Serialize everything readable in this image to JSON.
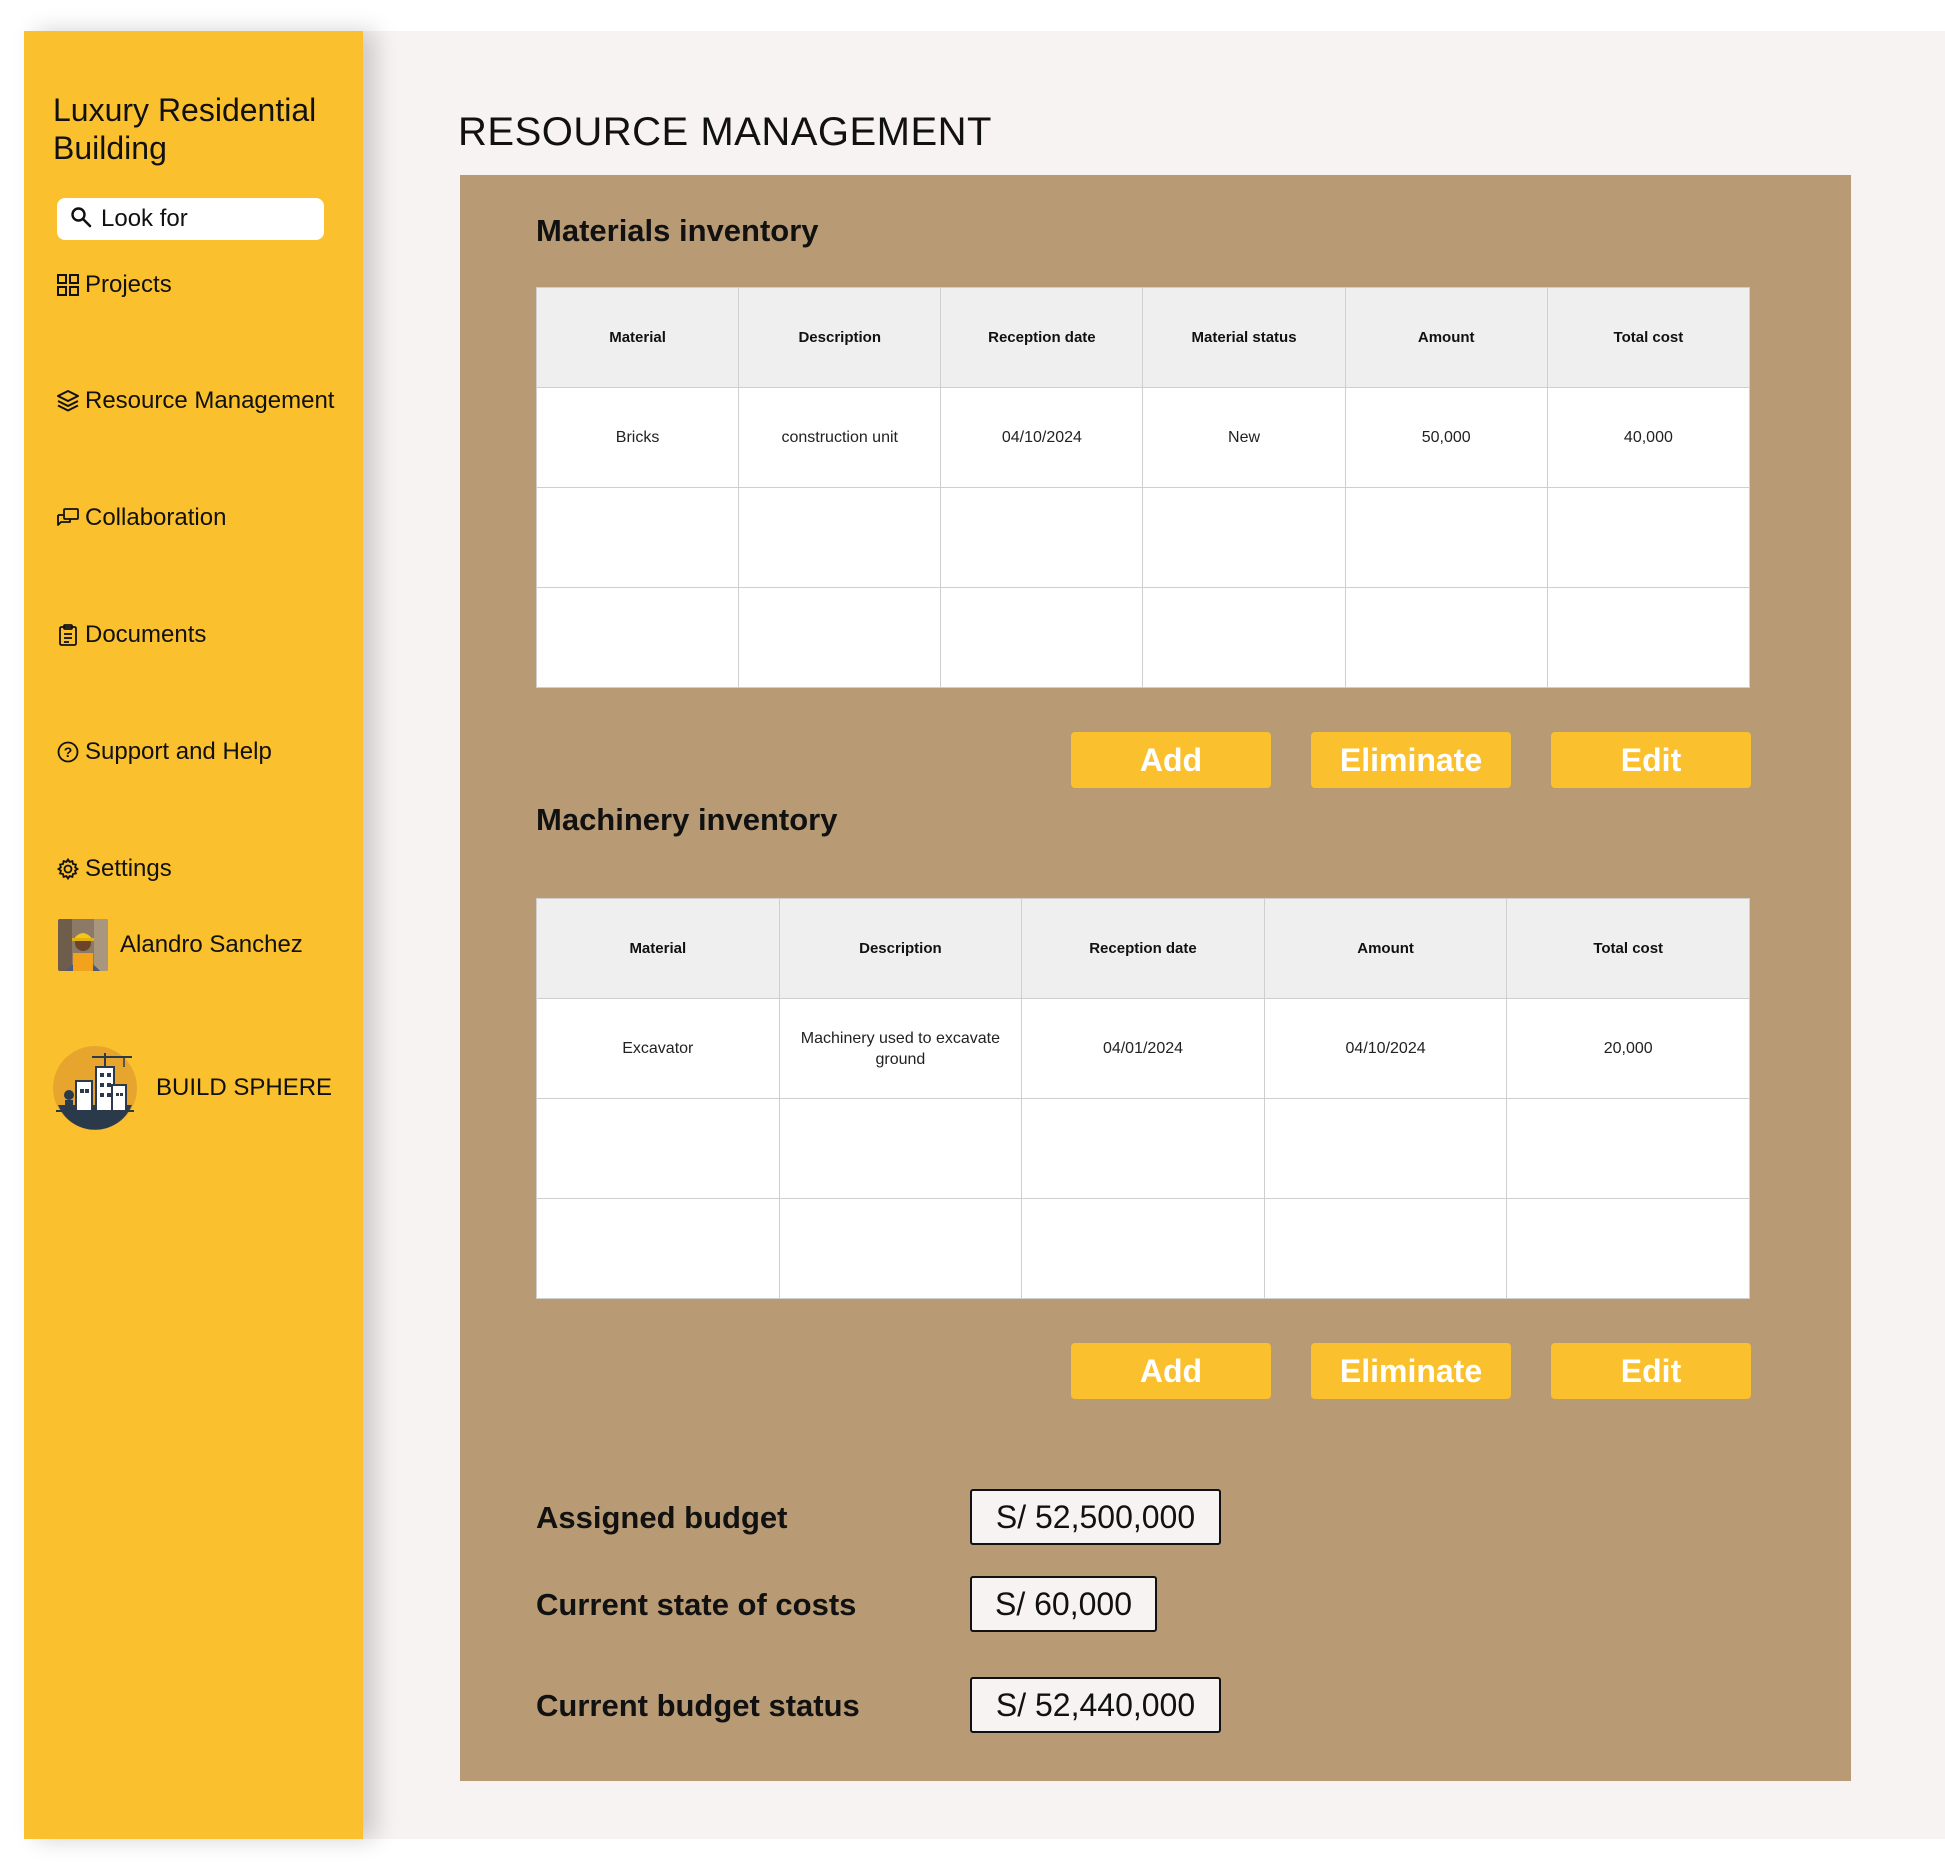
{
  "sidebar": {
    "project_title": "Luxury Residential Building",
    "search": {
      "placeholder": "Look for"
    },
    "items": [
      {
        "label": "Projects",
        "icon": "grid-icon"
      },
      {
        "label": "Resource Management",
        "icon": "layers-icon"
      },
      {
        "label": "Collaboration",
        "icon": "chat-icon"
      },
      {
        "label": "Documents",
        "icon": "clipboard-icon"
      },
      {
        "label": "Support and Help",
        "icon": "help-icon"
      },
      {
        "label": "Settings",
        "icon": "gear-icon"
      }
    ],
    "user": {
      "name": "Alandro Sanchez"
    },
    "brand": {
      "name": "BUILD SPHERE"
    }
  },
  "main": {
    "title": "RESOURCE MANAGEMENT",
    "materials": {
      "title": "Materials inventory",
      "columns": [
        "Material",
        "Description",
        "Reception date",
        "Material status",
        "Amount",
        "Total cost"
      ],
      "rows": [
        [
          "Bricks",
          "construction unit",
          "04/10/2024",
          "New",
          "50,000",
          "40,000"
        ],
        [
          "",
          "",
          "",
          "",
          "",
          ""
        ],
        [
          "",
          "",
          "",
          "",
          "",
          ""
        ]
      ],
      "buttons": {
        "add": "Add",
        "eliminate": "Eliminate",
        "edit": "Edit"
      }
    },
    "machinery": {
      "title": "Machinery inventory",
      "columns": [
        "Material",
        "Description",
        "Reception date",
        "Amount",
        "Total cost"
      ],
      "rows": [
        [
          "Excavator",
          "Machinery used to excavate ground",
          "04/01/2024",
          "04/10/2024",
          "20,000"
        ],
        [
          "",
          "",
          "",
          "",
          ""
        ],
        [
          "",
          "",
          "",
          "",
          ""
        ]
      ],
      "buttons": {
        "add": "Add",
        "eliminate": "Eliminate",
        "edit": "Edit"
      }
    },
    "budget": {
      "assigned_label": "Assigned budget",
      "assigned_value": "S/ 52,500,000",
      "costs_label": "Current state of costs",
      "costs_value": "S/ 60,000",
      "status_label": "Current budget status",
      "status_value": "S/ 52,440,000"
    }
  },
  "colors": {
    "sidebar": "#fbc02d",
    "panel": "#b89b74",
    "button": "#fbc02d",
    "page_bg": "#f6f3f2"
  }
}
